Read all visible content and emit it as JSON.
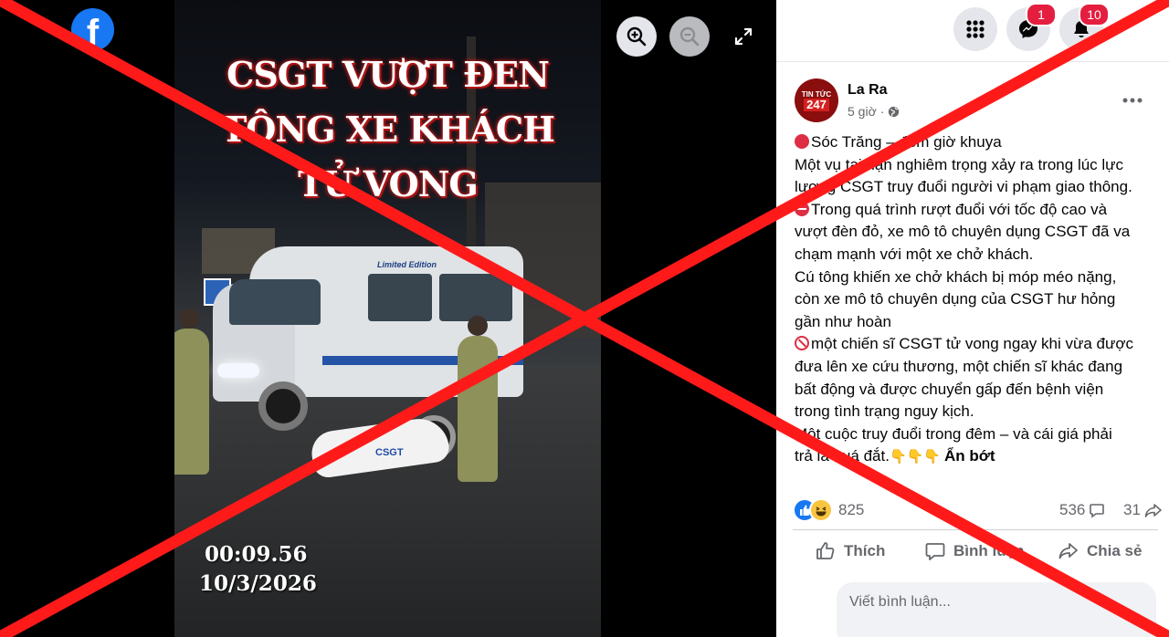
{
  "viewer": {
    "video_title_lines": [
      "CSGT VƯỢT ĐEN",
      "TÔNG XE KHÁCH",
      "TỬ VONG"
    ],
    "timestamp_time": "00:09.56",
    "timestamp_date": "10/3/2026",
    "van_brand": "Limited Edition",
    "moto_label": "CSGT",
    "icons": {
      "logo": "facebook-logo",
      "zoom_in": "zoom-in-icon",
      "zoom_out": "zoom-out-icon",
      "fullscreen": "fullscreen-icon"
    }
  },
  "topbar": {
    "messenger_badge": "1",
    "notifications_badge": "10"
  },
  "post": {
    "author": "La Ra",
    "avatar_line1": "TIN TỨC",
    "avatar_line2": "247",
    "time": "5 giờ",
    "separator": "·",
    "lines": [
      "Sóc Trăng – đêm giờ khuya",
      "Một vụ tai nạn nghiêm trọng xảy ra trong lúc lực",
      "lượng CSGT truy đuổi người vi phạm giao thông.",
      "Trong quá trình rượt đuổi với tốc độ cao và",
      "vượt đèn đỏ, xe mô tô chuyên dụng CSGT đã va",
      "chạm mạnh với một xe chở khách.",
      "Cú tông khiến xe chở khách bị móp méo nặng,",
      "còn xe mô tô chuyên dụng của CSGT hư hỏng",
      "gần như hoàn",
      "một chiến sĩ CSGT tử vong ngay khi vừa được",
      "đưa lên xe cứu thương, một chiến sĩ khác đang",
      "bất động và được chuyển gấp đến bệnh viện",
      "trong tình trạng nguy kịch.",
      "Một cuộc truy đuổi trong đêm – và cái giá phải",
      "trả là quá đắt."
    ],
    "hands": "👇👇👇",
    "see_less": "Ẩn bớt",
    "reactions_count": "825",
    "comments_count": "536",
    "shares_count": "31",
    "actions": {
      "like": "Thích",
      "comment": "Bình luận",
      "share": "Chia sẻ"
    },
    "comment_placeholder": "Viết bình luận..."
  },
  "colors": {
    "facebook_blue": "#1877f2",
    "badge_red": "#e41e3f",
    "x_overlay_red": "#ff1a1a",
    "title_glow_red": "#c41b1b"
  }
}
